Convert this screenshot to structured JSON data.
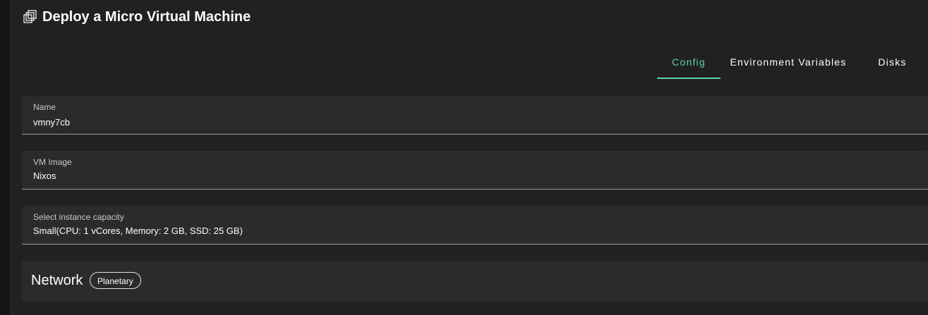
{
  "header": {
    "title": "Deploy a Micro Virtual Machine",
    "icon": "vm-stack-icon"
  },
  "tabs": [
    {
      "label": "Config",
      "active": true
    },
    {
      "label": "Environment Variables",
      "active": false
    },
    {
      "label": "Disks",
      "active": false
    }
  ],
  "form": {
    "name": {
      "label": "Name",
      "value": "vmny7cb"
    },
    "image": {
      "label": "VM Image",
      "value": "Nixos"
    },
    "capacity": {
      "label": "Select instance capacity",
      "value": "Small(CPU: 1 vCores, Memory: 2 GB, SSD: 25 GB)"
    }
  },
  "network": {
    "title": "Network",
    "chip": "Planetary"
  },
  "colors": {
    "accent": "#5fd3b3",
    "panel": "#212121",
    "field": "#2b2b2b"
  }
}
